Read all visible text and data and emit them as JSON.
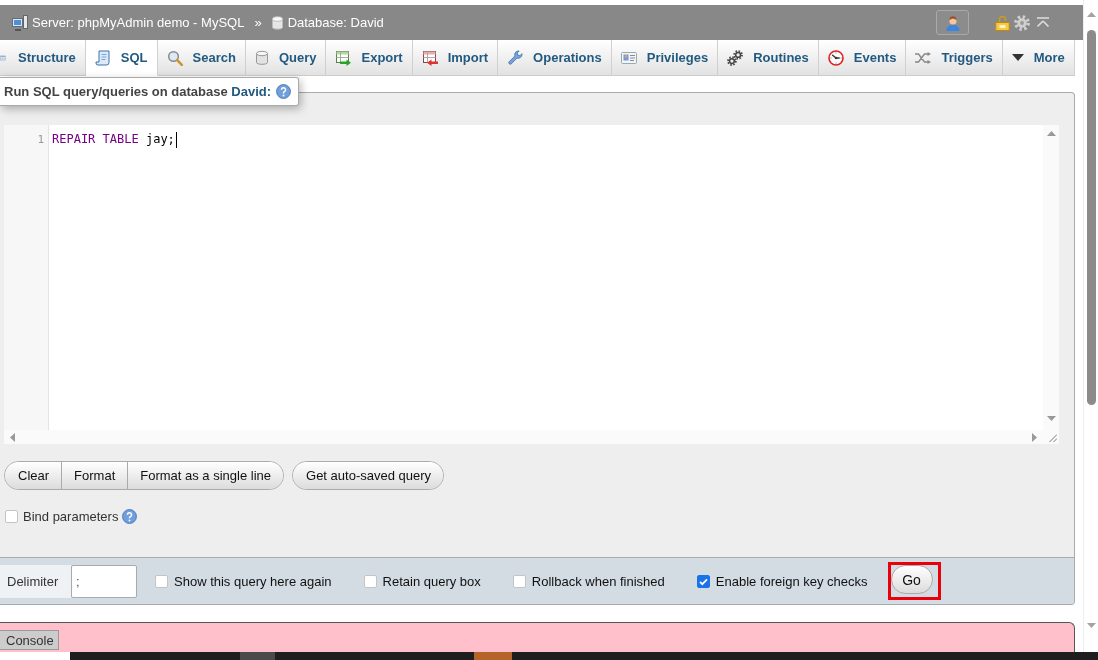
{
  "breadcrumb": {
    "server": "Server: phpMyAdmin demo - MySQL",
    "separator": "»",
    "database": "Database: David"
  },
  "tabs": [
    {
      "label": "Structure",
      "selected": false
    },
    {
      "label": "SQL",
      "selected": true
    },
    {
      "label": "Search",
      "selected": false
    },
    {
      "label": "Query",
      "selected": false
    },
    {
      "label": "Export",
      "selected": false
    },
    {
      "label": "Import",
      "selected": false
    },
    {
      "label": "Operations",
      "selected": false
    },
    {
      "label": "Privileges",
      "selected": false
    },
    {
      "label": "Routines",
      "selected": false
    },
    {
      "label": "Events",
      "selected": false
    },
    {
      "label": "Triggers",
      "selected": false
    },
    {
      "label": "More",
      "selected": false
    }
  ],
  "query_panel": {
    "legend": "Run SQL query/queries on database",
    "database_link": "David:",
    "editor": {
      "line_numbers": [
        "1"
      ],
      "tokens": [
        {
          "kind": "keyword",
          "text": "REPAIR TABLE"
        },
        {
          "kind": "plain",
          "text": "jay;"
        }
      ],
      "focused": true
    },
    "button_groups": [
      {
        "buttons": [
          "Clear",
          "Format",
          "Format as a single line"
        ]
      },
      {
        "buttons": [
          "Get auto-saved query"
        ]
      }
    ],
    "bind_parameters": {
      "label": "Bind parameters",
      "checked": false
    }
  },
  "footer": {
    "delimiter_label": "Delimiter",
    "delimiter_value": ";",
    "options": [
      {
        "label": "Show this query here again",
        "checked": false
      },
      {
        "label": "Retain query box",
        "checked": false
      },
      {
        "label": "Rollback when finished",
        "checked": false
      },
      {
        "label": "Enable foreign key checks",
        "checked": true
      }
    ],
    "go_button": {
      "label": "Go",
      "highlighted": true
    }
  },
  "console": {
    "tab": "Console"
  }
}
